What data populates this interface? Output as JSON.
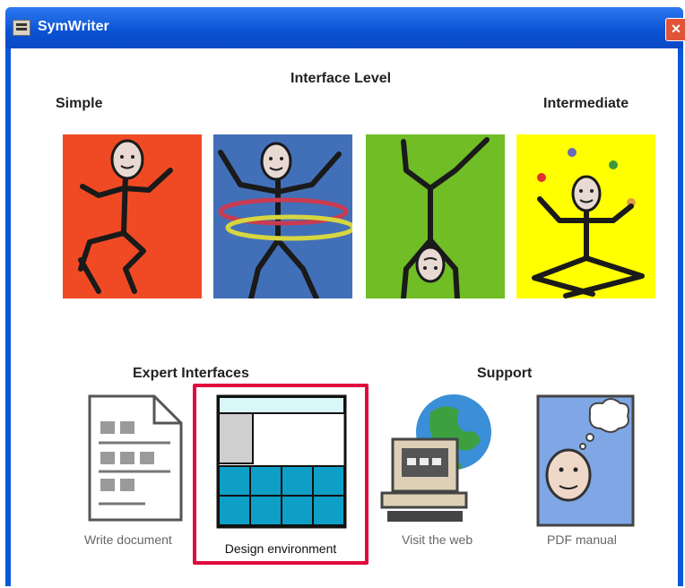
{
  "window": {
    "title": "SymWriter",
    "close_glyph": "✕"
  },
  "interface_level": {
    "heading": "Interface Level",
    "left_label": "Simple",
    "right_label": "Intermediate",
    "panels": [
      {
        "name": "level-1-dancer",
        "bg": "#f04a24"
      },
      {
        "name": "level-2-hula-hoop",
        "bg": "#4270b8"
      },
      {
        "name": "level-3-handstand",
        "bg": "#70bd25"
      },
      {
        "name": "level-4-juggler",
        "bg": "#ffff00"
      }
    ]
  },
  "expert": {
    "heading": "Expert Interfaces"
  },
  "support": {
    "heading": "Support"
  },
  "tiles": [
    {
      "label": "Write document",
      "icon": "document-icon"
    },
    {
      "label": "Design environment",
      "icon": "layout-grid-icon",
      "selected": true
    },
    {
      "label": "Visit the web",
      "icon": "computer-globe-icon"
    },
    {
      "label": "PDF manual",
      "icon": "thinking-face-icon"
    }
  ],
  "colors": {
    "accent_selection": "#e00a3c",
    "title_bar": "#0a52d4"
  }
}
